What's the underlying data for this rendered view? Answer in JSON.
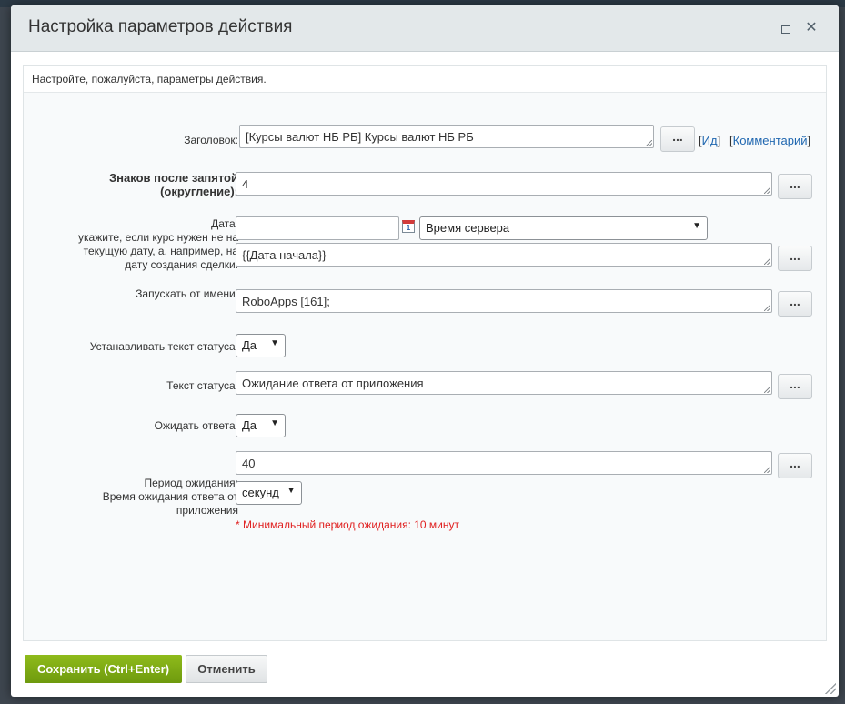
{
  "dialog": {
    "title": "Настройка параметров действия",
    "intro": "Настройте, пожалуйста, параметры действия."
  },
  "fields": {
    "title": {
      "label": "Заголовок:",
      "value": "[Курсы валют НБ РБ] Курсы валют НБ РБ",
      "id_link": "Ид",
      "comment_link": "Комментарий"
    },
    "decimals": {
      "label_line1": "Знаков после запятой",
      "label_line2": "(округление):",
      "value": "4"
    },
    "date": {
      "label_line1": "Дата:",
      "label_line2": "укажите, если курс нужен не на",
      "label_line3": "текущую дату, а, например, на",
      "label_line4": "дату создания сделки.",
      "date_value": "",
      "calendar_icon": "calendar-icon",
      "timezone_selected": "Время сервера",
      "expression_value": "{{Дата начала}}"
    },
    "run_as": {
      "label": "Запускать от имени:",
      "value": "RoboApps [161];"
    },
    "set_status": {
      "label": "Устанавливать текст статуса:",
      "selected": "Да"
    },
    "status_text": {
      "label": "Текст статуса:",
      "value": "Ожидание ответа от приложения"
    },
    "wait": {
      "label": "Ожидать ответа:",
      "selected": "Да"
    },
    "timeout": {
      "label_line1": "Период ожидания:",
      "label_line2": "Время ожидания ответа от",
      "label_line3": "приложения",
      "value": "40",
      "unit_selected": "секунд",
      "note": "* Минимальный период ожидания: 10 минут"
    }
  },
  "ellipsis_label": "...",
  "footer": {
    "save_label": "Сохранить (Ctrl+Enter)",
    "cancel_label": "Отменить"
  },
  "colors": {
    "save_button": "#7aa613",
    "note_text": "#e02020",
    "link": "#2067b0"
  }
}
